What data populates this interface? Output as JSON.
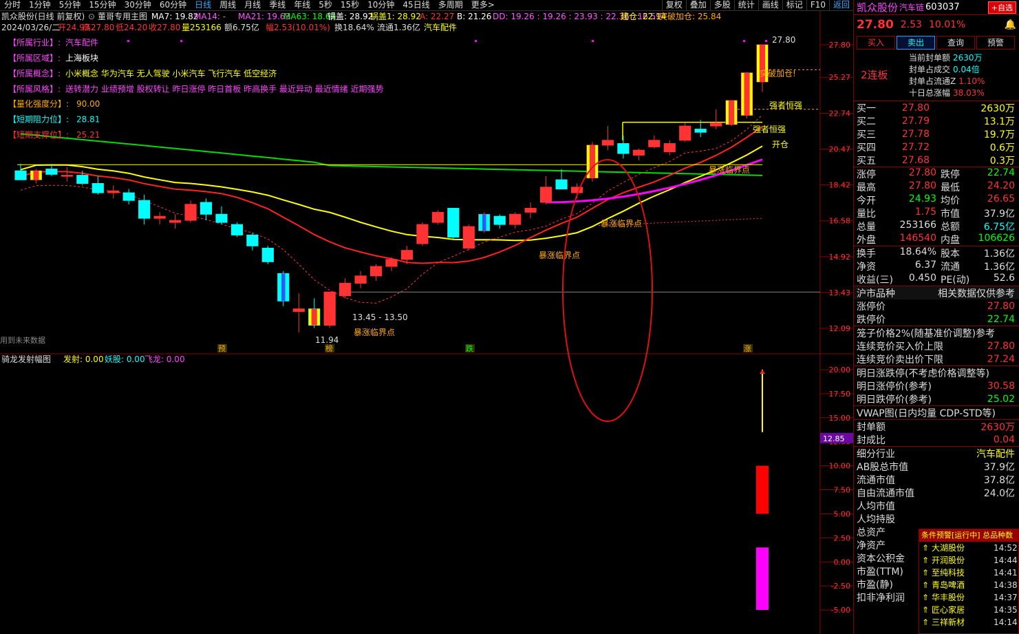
{
  "topbar": {
    "tabs": [
      "分时",
      "1分钟",
      "5分钟",
      "15分钟",
      "30分钟",
      "60分钟",
      "日线",
      "周线",
      "月线",
      "季线",
      "年线",
      "5秒",
      "15秒",
      "10分钟",
      "45日线",
      "多周期",
      "更多>"
    ],
    "active": "日线",
    "tools": [
      "复权",
      "叠加",
      "多股",
      "统计",
      "画线",
      "标记",
      "F10",
      "返回"
    ]
  },
  "info": {
    "line1": {
      "stock": "凯众股份(日线 前复权)",
      "formula": "董哥专用主图",
      "items": [
        {
          "t": "MA7: 19.82",
          "c": "#ffffff"
        },
        {
          "t": "MA14: -",
          "c": "#ff55ff"
        },
        {
          "t": "MA21: 19.63",
          "c": "#ff55ff"
        },
        {
          "t": "MA63: 18.69",
          "c": "#00ff00"
        },
        {
          "t": "锅盖: 28.92",
          "c": "#ffffff"
        },
        {
          "t": "锅盖1: 28.92",
          "c": "#ffff00"
        },
        {
          "t": "A: 22.27",
          "c": "#ff3333"
        },
        {
          "t": "B: 21.26",
          "c": "#ffffff"
        },
        {
          "t": "DD: 19.26 : 19.26 : 23.93 : 22.36 : 16.59",
          "c": "#ff55ff"
        },
        {
          "t": "建仓: 22.14",
          "c": "#ffff00"
        },
        {
          "t": "突破加仓: 25.84",
          "c": "#ffaa00"
        }
      ]
    },
    "line2": [
      {
        "t": "2024/03/26/二",
        "c": "#dddddd"
      },
      {
        "t": "开24.93",
        "c": "#ff3333"
      },
      {
        "t": "高27.80",
        "c": "#ff3333"
      },
      {
        "t": "低24.20",
        "c": "#ff3333"
      },
      {
        "t": "收27.80",
        "c": "#ff3333"
      },
      {
        "t": "量253166",
        "c": "#ffff00"
      },
      {
        "t": "额6.75亿",
        "c": "#dddddd"
      },
      {
        "t": "幅2.53(10.01%)",
        "c": "#ff3333"
      },
      {
        "t": "换18.64%",
        "c": "#dddddd"
      },
      {
        "t": "流通1.36亿",
        "c": "#dddddd"
      },
      {
        "t": "汽车配件",
        "c": "#ffff00"
      }
    ],
    "tags": [
      {
        "k": "【所属行业】:",
        "v": "汽车配件",
        "kc": "#ff44ff",
        "vc": "#ff44ff"
      },
      {
        "k": "【所属区域】:",
        "v": "上海板块",
        "kc": "#ff44ff",
        "vc": "#ffffff"
      },
      {
        "k": "【所属概念】:",
        "v": "小米概念 华为汽车 无人驾驶 小米汽车 飞行汽车 低空经济",
        "kc": "#ff44ff",
        "vc": "#ffff00"
      },
      {
        "k": "【所属风格】:",
        "v": "送转潜力 业绩预增 股权转让 昨日涨停 昨日首板 昨高换手 最近异动 最近情绪 近期强势",
        "kc": "#ff44ff",
        "vc": "#ff44ff"
      },
      {
        "k": "【量化强度分】:",
        "v": "90.00",
        "kc": "#ffaa00",
        "vc": "#ffaa00"
      },
      {
        "k": "【短期阻力位】:",
        "v": "28.81",
        "kc": "#00ffff",
        "vc": "#00ffff"
      },
      {
        "k": "【短期支撑位】:",
        "v": "25.21",
        "kc": "#ff3333",
        "vc": "#ff3333"
      }
    ],
    "future_note": "用到未来数据"
  },
  "chart_data": [
    {
      "type": "candlestick",
      "title": "董哥专用主图",
      "yticks": [
        "27.80",
        "25.27",
        "22.74",
        "20.47",
        "18.42",
        "16.58",
        "14.92",
        "13.43",
        "12.09"
      ],
      "candles": [
        {
          "o": 19.2,
          "h": 19.6,
          "l": 18.8,
          "c": 18.7
        },
        {
          "o": 18.7,
          "h": 19.3,
          "l": 18.5,
          "c": 19.2
        },
        {
          "o": 19.3,
          "h": 19.6,
          "l": 18.9,
          "c": 19.0
        },
        {
          "o": 18.9,
          "h": 19.4,
          "l": 18.6,
          "c": 18.95
        },
        {
          "o": 18.95,
          "h": 19.2,
          "l": 18.4,
          "c": 18.5
        },
        {
          "o": 18.5,
          "h": 18.9,
          "l": 17.9,
          "c": 18.0
        },
        {
          "o": 18.0,
          "h": 18.4,
          "l": 17.7,
          "c": 18.1
        },
        {
          "o": 18.0,
          "h": 18.2,
          "l": 17.4,
          "c": 17.6
        },
        {
          "o": 17.6,
          "h": 17.9,
          "l": 16.4,
          "c": 16.7
        },
        {
          "o": 16.7,
          "h": 17.0,
          "l": 16.4,
          "c": 16.8
        },
        {
          "o": 16.5,
          "h": 16.9,
          "l": 16.2,
          "c": 16.6
        },
        {
          "o": 16.6,
          "h": 17.6,
          "l": 16.5,
          "c": 17.4
        },
        {
          "o": 17.5,
          "h": 17.7,
          "l": 16.6,
          "c": 16.9
        },
        {
          "o": 16.9,
          "h": 17.3,
          "l": 16.4,
          "c": 16.5
        },
        {
          "o": 16.4,
          "h": 16.5,
          "l": 15.8,
          "c": 15.9
        },
        {
          "o": 15.9,
          "h": 16.0,
          "l": 15.2,
          "c": 15.4
        },
        {
          "o": 15.3,
          "h": 15.4,
          "l": 14.6,
          "c": 14.7
        },
        {
          "o": 14.2,
          "h": 14.3,
          "l": 12.9,
          "c": 13.1
        },
        {
          "o": 12.7,
          "h": 13.4,
          "l": 11.94,
          "c": 12.8
        },
        {
          "o": 12.8,
          "h": 13.2,
          "l": 12.1,
          "c": 12.2
        },
        {
          "o": 12.2,
          "h": 13.45,
          "l": 12.1,
          "c": 13.45
        },
        {
          "o": 13.3,
          "h": 14.0,
          "l": 13.2,
          "c": 13.8
        },
        {
          "o": 13.8,
          "h": 14.3,
          "l": 13.6,
          "c": 14.1
        },
        {
          "o": 14.1,
          "h": 14.6,
          "l": 13.9,
          "c": 14.5
        },
        {
          "o": 14.5,
          "h": 14.9,
          "l": 14.3,
          "c": 14.8
        },
        {
          "o": 14.8,
          "h": 15.4,
          "l": 14.6,
          "c": 15.2
        },
        {
          "o": 15.5,
          "h": 16.5,
          "l": 15.4,
          "c": 16.4
        },
        {
          "o": 16.5,
          "h": 17.1,
          "l": 16.4,
          "c": 17.0
        },
        {
          "o": 17.2,
          "h": 17.2,
          "l": 15.7,
          "c": 15.8
        },
        {
          "o": 15.3,
          "h": 16.4,
          "l": 15.2,
          "c": 16.3
        },
        {
          "o": 16.1,
          "h": 17.0,
          "l": 16.0,
          "c": 16.9
        },
        {
          "o": 16.8,
          "h": 16.9,
          "l": 16.2,
          "c": 16.4
        },
        {
          "o": 16.4,
          "h": 17.0,
          "l": 16.2,
          "c": 16.9
        },
        {
          "o": 17.0,
          "h": 17.5,
          "l": 16.7,
          "c": 17.2
        },
        {
          "o": 17.5,
          "h": 18.9,
          "l": 17.4,
          "c": 18.3
        },
        {
          "o": 18.7,
          "h": 19.3,
          "l": 18.2,
          "c": 18.2
        },
        {
          "o": 18.0,
          "h": 18.5,
          "l": 17.7,
          "c": 18.3
        },
        {
          "o": 18.8,
          "h": 20.9,
          "l": 18.6,
          "c": 20.7
        },
        {
          "o": 20.7,
          "h": 21.9,
          "l": 20.4,
          "c": 21.0
        },
        {
          "o": 20.8,
          "h": 21.3,
          "l": 19.9,
          "c": 20.2
        },
        {
          "o": 20.1,
          "h": 20.5,
          "l": 19.8,
          "c": 20.4
        },
        {
          "o": 20.6,
          "h": 21.3,
          "l": 20.5,
          "c": 21.0
        },
        {
          "o": 20.3,
          "h": 21.0,
          "l": 20.1,
          "c": 20.8
        },
        {
          "o": 21.0,
          "h": 22.1,
          "l": 20.9,
          "c": 21.9
        },
        {
          "o": 21.7,
          "h": 22.3,
          "l": 21.2,
          "c": 21.5
        },
        {
          "o": 21.9,
          "h": 23.0,
          "l": 21.7,
          "c": 22.1
        },
        {
          "o": 22.0,
          "h": 23.6,
          "l": 21.9,
          "c": 23.6
        },
        {
          "o": 22.6,
          "h": 25.6,
          "l": 22.4,
          "c": 25.6
        },
        {
          "o": 24.93,
          "h": 27.8,
          "l": 24.2,
          "c": 27.8
        }
      ],
      "annotations": [
        "27.80",
        "突破加仓!",
        "强者恒强",
        "强者恒强",
        "开仓",
        "暴涨临界点",
        "暴涨临界点",
        "暴涨临界点",
        "暴涨临界点",
        "13.45 - 13.50",
        "11.94"
      ],
      "markers": [
        "预",
        "榜",
        "跌",
        "涨"
      ]
    },
    {
      "type": "bar",
      "title": "骑龙发射幅图",
      "legend": [
        {
          "t": "发射: 0.00",
          "c": "#ffff00"
        },
        {
          "t": "妖股: 0.00",
          "c": "#00ffff"
        },
        {
          "t": "飞龙: 0.00",
          "c": "#ff44ff"
        }
      ],
      "yticks": [
        "20.00",
        "17.50",
        "15.00",
        "12.50",
        "10.00",
        "7.50",
        "5.00",
        "2.50",
        "0.00",
        "-2.50",
        "-5.00"
      ],
      "current_value_label": "12.85",
      "bars": [
        {
          "name": "飞龙",
          "from": -5.0,
          "to": 1.5,
          "color": "#ff00ff"
        },
        {
          "name": "妖股",
          "from": 5.0,
          "to": 10.0,
          "color": "#ff0000"
        },
        {
          "name": "发射",
          "from": 13.5,
          "to": 20.0,
          "color": "#ffff00"
        }
      ]
    }
  ],
  "quote": {
    "name": "凯众股份",
    "industry": "汽车链",
    "code": "603037",
    "add_btn": "+自选",
    "price": "27.80",
    "change": "2.53",
    "pct": "10.01%",
    "buttons": [
      "买入",
      "卖出",
      "查询",
      "预警"
    ],
    "streak": "2连板",
    "limit_stats": [
      {
        "k": "当前封单额",
        "v": "2630万"
      },
      {
        "k": "封单占成交",
        "v": "0.04倍"
      },
      {
        "k": "封单占流通Z",
        "v": "1.10%"
      },
      {
        "k": "十日总涨幅",
        "v": "38.03%"
      }
    ],
    "bids": [
      {
        "l": "买一",
        "p": "27.80",
        "v": "2630万"
      },
      {
        "l": "买二",
        "p": "27.79",
        "v": "13.1万"
      },
      {
        "l": "买三",
        "p": "27.78",
        "v": "19.7万"
      },
      {
        "l": "买四",
        "p": "27.72",
        "v": "0.6万"
      },
      {
        "l": "买五",
        "p": "27.68",
        "v": "0.3万"
      }
    ],
    "stats": [
      [
        {
          "k": "涨停",
          "v": "27.80",
          "c": "red"
        },
        {
          "k": "跌停",
          "v": "22.74",
          "c": "green"
        }
      ],
      [
        {
          "k": "最高",
          "v": "27.80",
          "c": "red"
        },
        {
          "k": "最低",
          "v": "24.20",
          "c": "red"
        }
      ],
      [
        {
          "k": "今开",
          "v": "24.93",
          "c": "green"
        },
        {
          "k": "均价",
          "v": "26.65",
          "c": "red"
        }
      ],
      [
        {
          "k": "量比",
          "v": "1.75",
          "c": "red"
        },
        {
          "k": "市值",
          "v": "37.9亿",
          "c": "white"
        }
      ],
      [
        {
          "k": "总量",
          "v": "253166",
          "c": "white"
        },
        {
          "k": "总额",
          "v": "6.75亿",
          "c": "cyan"
        }
      ],
      [
        {
          "k": "外盘",
          "v": "146540",
          "c": "red"
        },
        {
          "k": "内盘",
          "v": "106626",
          "c": "green"
        }
      ]
    ],
    "stats2": [
      [
        {
          "k": "换手",
          "v": "18.64%"
        },
        {
          "k": "股本",
          "v": "1.36亿"
        }
      ],
      [
        {
          "k": "净资",
          "v": "6.37"
        },
        {
          "k": "流通",
          "v": "1.36亿"
        }
      ],
      [
        {
          "k": "收益(三)",
          "v": "0.450"
        },
        {
          "k": "PE(动)",
          "v": "52.6"
        }
      ]
    ],
    "market_title": "沪市品种",
    "market_note": "相关数据仅供参考",
    "limit_up_label": "涨停价",
    "limit_up": "27.80",
    "limit_down_label": "跌停价",
    "limit_down": "22.74",
    "cage_title": "笼子价格2%(随基准价调整)参考",
    "auction": [
      {
        "k": "连续竞价买入价上限",
        "v": "27.80"
      },
      {
        "k": "连续竞价卖出价下限",
        "v": "27.24"
      }
    ],
    "tomorrow_title": "明日涨跌停(不考虑价格调整等)",
    "tomorrow": [
      {
        "k": "明日涨停价(参考)",
        "v": "30.58",
        "c": "red"
      },
      {
        "k": "明日跌停价(参考)",
        "v": "25.02",
        "c": "green"
      }
    ],
    "vwap_title": "VWAP图(日内均量 CDP-STD等)",
    "seal": [
      {
        "k": "封单额",
        "v": "2630万"
      },
      {
        "k": "封成比",
        "v": "0.04"
      }
    ],
    "fund": [
      {
        "k": "细分行业",
        "v": "汽车配件",
        "c": "yellow"
      },
      {
        "k": "AB股总市值",
        "v": "37.9亿",
        "c": "white"
      },
      {
        "k": "流通市值",
        "v": "37.8亿",
        "c": "white"
      },
      {
        "k": "自由流通市值",
        "v": "24.0亿",
        "c": "white"
      }
    ],
    "fund_more": [
      "人均市值",
      "人均持股",
      "总资产",
      "净资产",
      "资本公积金",
      "市盈(TTM)",
      "市盈(静)",
      "扣非净利润"
    ]
  },
  "alerts": {
    "title": "条件预警[运行中] 总品种数",
    "rows": [
      {
        "name": "大湖股份",
        "time": "14:52"
      },
      {
        "name": "开润股份",
        "time": "14:44"
      },
      {
        "name": "至纯科技",
        "time": "14:41"
      },
      {
        "name": "青岛啤酒",
        "time": "14:38"
      },
      {
        "name": "华丰股份",
        "time": "14:37"
      },
      {
        "name": "匠心家居",
        "time": "14:35"
      },
      {
        "name": "三祥新材",
        "time": "14:14"
      }
    ]
  },
  "colors": {
    "up": "#ff3333",
    "down": "#00ffff",
    "ma_white": "#ffff00",
    "ma_red": "#ff2222",
    "ma_green": "#00dd00",
    "ma_mag": "#ff00ff"
  }
}
